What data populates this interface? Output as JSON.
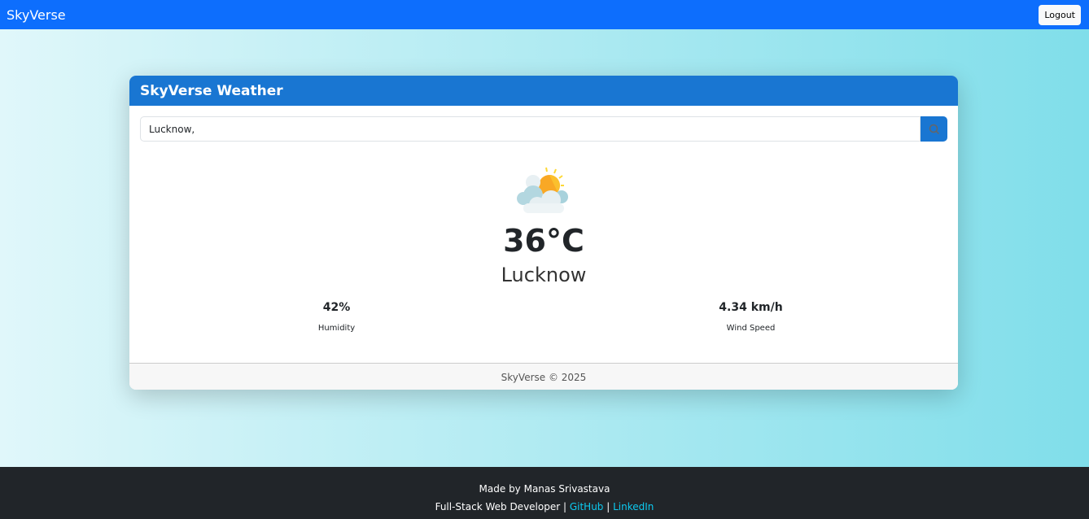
{
  "navbar": {
    "brand": "SkyVerse",
    "logout_label": "Logout"
  },
  "card": {
    "title": "SkyVerse Weather",
    "search_value": "Lucknow,",
    "weather_icon": "partly-cloudy-sun-icon",
    "temperature": "36°C",
    "city": "Lucknow",
    "stats": [
      {
        "value": "42%",
        "label": "Humidity"
      },
      {
        "value": "4.34 km/h",
        "label": "Wind Speed"
      }
    ],
    "footer": "SkyVerse © 2025"
  },
  "footer": {
    "line1": "Made by Manas Srivastava",
    "role": "Full-Stack Web Developer",
    "sep": " | ",
    "github": "GitHub",
    "linkedin": "LinkedIn"
  }
}
